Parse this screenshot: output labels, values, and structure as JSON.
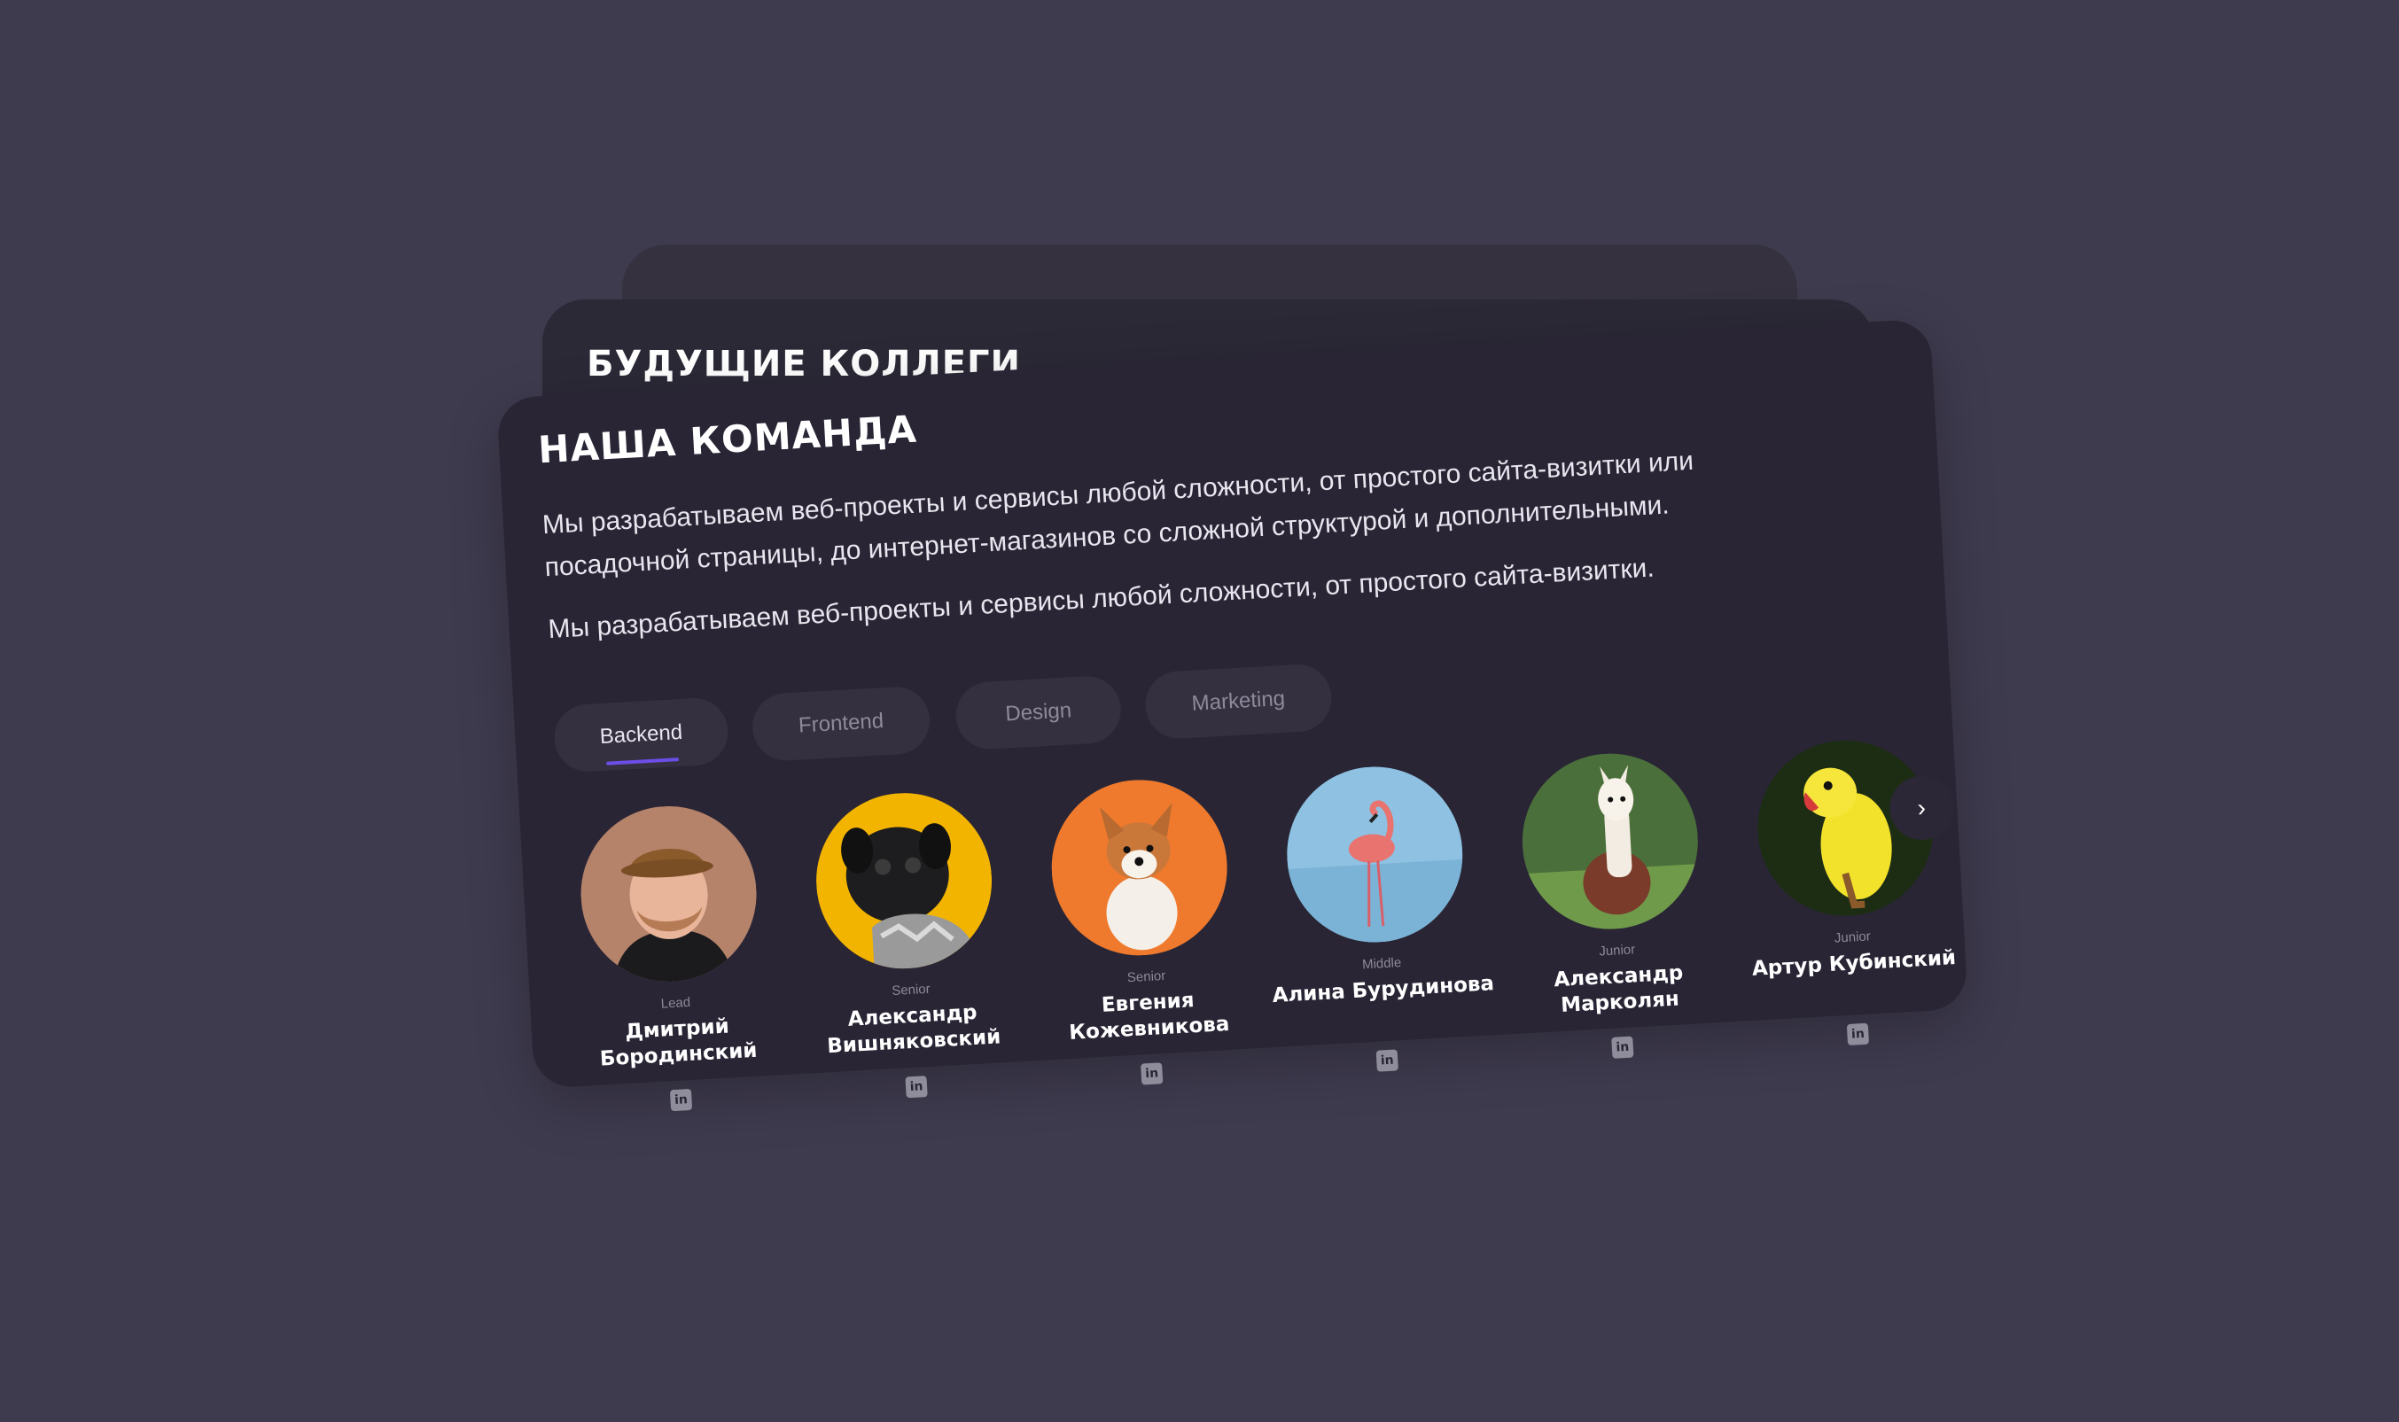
{
  "back_card": {
    "title": "БУДУЩИЕ КОЛЛЕГИ"
  },
  "main_card": {
    "title": "НАША КОМАНДА",
    "description_1": "Мы разрабатываем веб-проекты и сервисы любой сложности, от простого сайта-визитки или посадочной страницы, до интернет-магазинов со сложной структурой и дополнительными.",
    "description_2": "Мы разрабатываем веб-проекты и сервисы любой сложности, от простого сайта-визитки.",
    "tabs": [
      {
        "label": "Backend",
        "active": true
      },
      {
        "label": "Frontend",
        "active": false
      },
      {
        "label": "Design",
        "active": false
      },
      {
        "label": "Marketing",
        "active": false
      }
    ],
    "members": [
      {
        "level": "Lead",
        "name": "Дмитрий Бородинский",
        "avatar": "man-portrait",
        "avatar_bg": "#b5826a"
      },
      {
        "level": "Senior",
        "name": "Александр Вишняковский",
        "avatar": "pug-photo",
        "avatar_bg": "#f3b400"
      },
      {
        "level": "Senior",
        "name": "Евгения Кожевникова",
        "avatar": "corgi-puppy-photo",
        "avatar_bg": "#ef7a2d"
      },
      {
        "level": "Middle",
        "name": "Алина Бурудинова",
        "avatar": "flamingo-photo",
        "avatar_bg": "#8ec1e2"
      },
      {
        "level": "Junior",
        "name": "Александр Марколян",
        "avatar": "alpaca-photo",
        "avatar_bg": "#4b6f3a"
      },
      {
        "level": "Junior",
        "name": "Артур Кубинский",
        "avatar": "yellow-parrot-photo",
        "avatar_bg": "#1d2d14"
      }
    ],
    "next_icon": "chevron-right-icon",
    "accent_color": "#6c4ee6"
  }
}
